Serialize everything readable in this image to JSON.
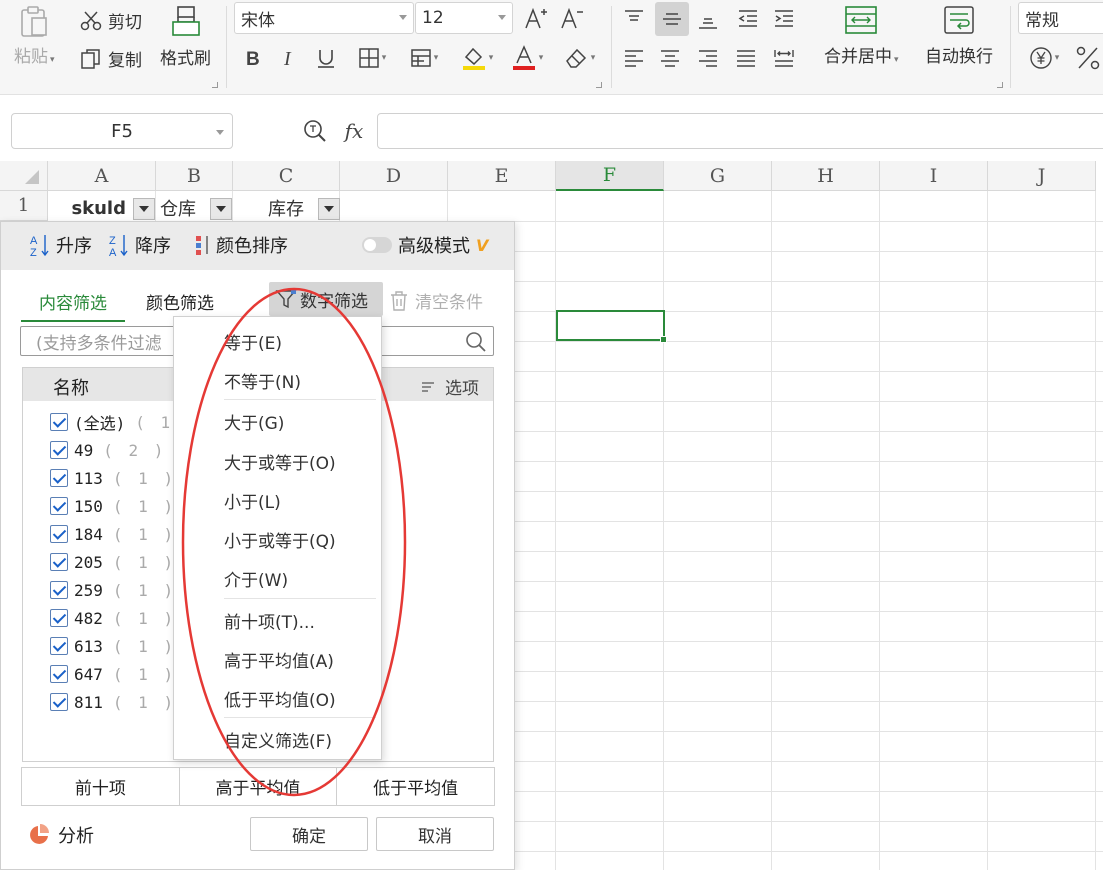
{
  "ribbon": {
    "paste": "粘贴",
    "cut": "剪切",
    "copy": "复制",
    "format_painter": "格式刷",
    "font_name": "宋体",
    "font_size": "12",
    "merge_center": "合并居中",
    "auto_wrap": "自动换行",
    "number_format": "常规",
    "colors": {
      "highlight": "#f5d90a",
      "font_red": "#e02020"
    }
  },
  "formula_bar": {
    "cell_ref": "F5",
    "fx": "fx"
  },
  "grid": {
    "columns": [
      "A",
      "B",
      "C",
      "D",
      "E",
      "F",
      "G",
      "H",
      "I",
      "J"
    ],
    "active_column": "F",
    "rows": [
      "1"
    ],
    "headers": {
      "a1": "skuld",
      "b1": "仓库",
      "c1": "库存"
    }
  },
  "filter_panel": {
    "sort_asc": "升序",
    "sort_desc": "降序",
    "color_sort": "颜色排序",
    "advanced_mode": "高级模式",
    "advanced_badge": "V",
    "tab_content": "内容筛选",
    "tab_color": "颜色筛选",
    "number_filter": "数字筛选",
    "clear_conditions": "清空条件",
    "search_placeholder": "(支持多条件过滤",
    "list_name_header": "名称",
    "list_options": "选项",
    "items": [
      {
        "label": "(全选)",
        "count": "( 11"
      },
      {
        "label": "49",
        "count": "( 2 )"
      },
      {
        "label": "113",
        "count": "( 1 )"
      },
      {
        "label": "150",
        "count": "( 1 )"
      },
      {
        "label": "184",
        "count": "( 1 )"
      },
      {
        "label": "205",
        "count": "( 1 )"
      },
      {
        "label": "259",
        "count": "( 1 )"
      },
      {
        "label": "482",
        "count": "( 1 )"
      },
      {
        "label": "613",
        "count": "( 1 )"
      },
      {
        "label": "647",
        "count": "( 1 )"
      },
      {
        "label": "811",
        "count": "( 1 )"
      }
    ],
    "quick_top10": "前十项",
    "quick_above_avg": "高于平均值",
    "quick_below_avg": "低于平均值",
    "analysis": "分析",
    "ok": "确定",
    "cancel": "取消"
  },
  "number_filter_menu": {
    "items": [
      "等于(E)",
      "不等于(N)",
      "大于(G)",
      "大于或等于(O)",
      "小于(L)",
      "小于或等于(Q)",
      "介于(W)",
      "前十项(T)...",
      "高于平均值(A)",
      "低于平均值(O)",
      "自定义筛选(F)"
    ]
  }
}
